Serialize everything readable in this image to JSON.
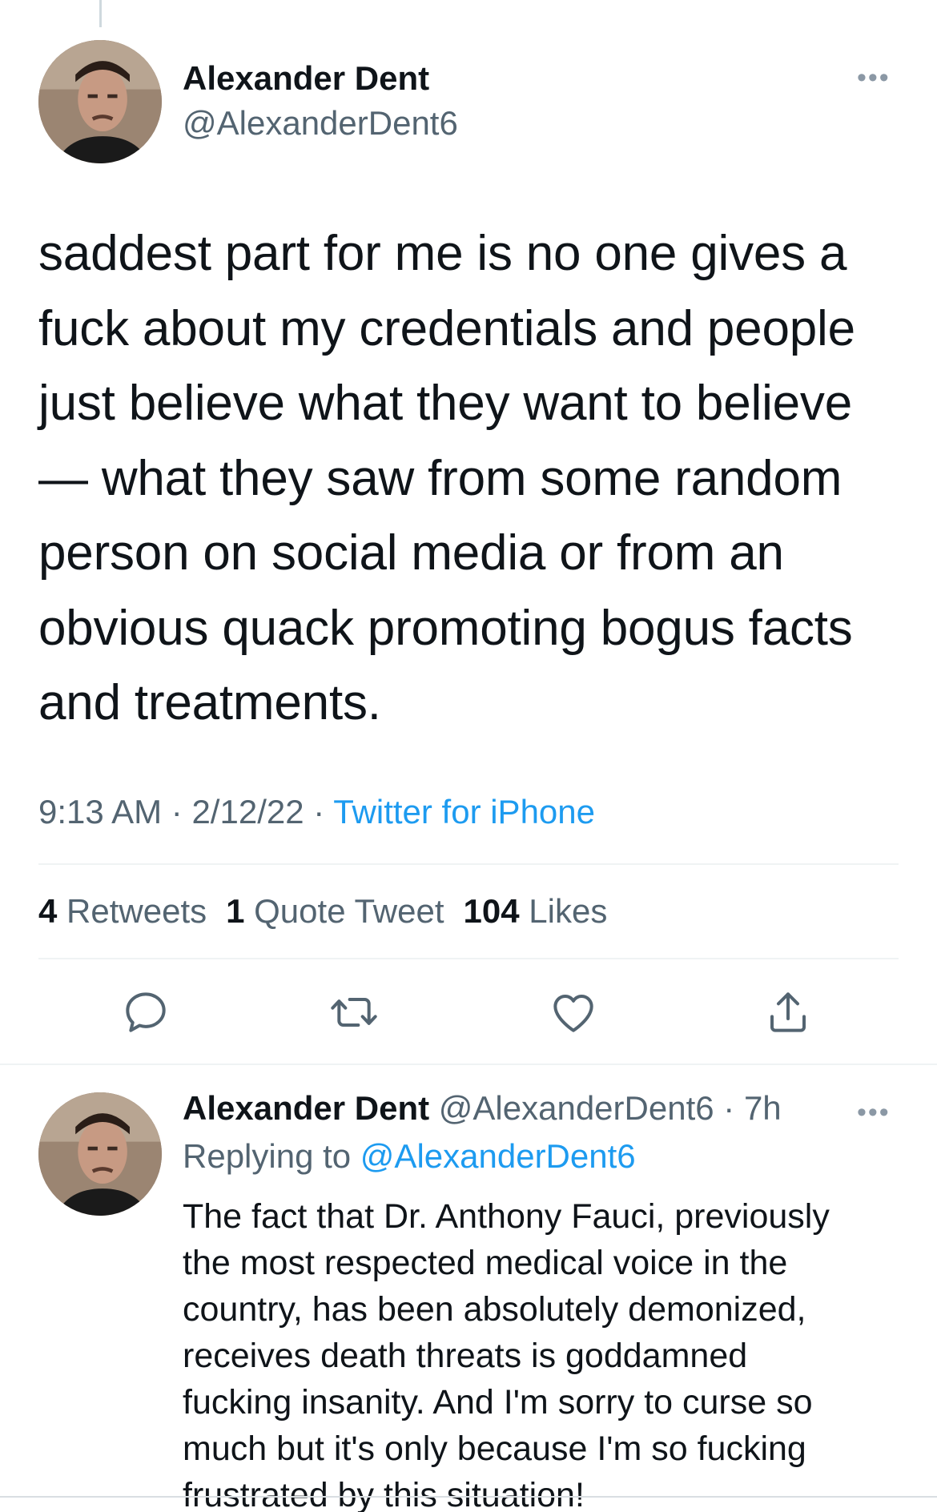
{
  "main_tweet": {
    "author_name": "Alexander Dent",
    "author_handle": "@AlexanderDent6",
    "text_lines": [
      "saddest part for me is no one gives a",
      "fuck about my credentials and people",
      "just believe what they want to believe",
      "— what they saw from some random",
      "person on social media or from an",
      "obvious quack promoting bogus facts",
      "and treatments."
    ],
    "time": "9:13 AM",
    "separator": "·",
    "date": "2/12/22",
    "source": "Twitter for iPhone",
    "stats": {
      "retweets_count": "4",
      "retweets_label": "Retweets",
      "quotes_count": "1",
      "quotes_label": "Quote Tweet",
      "likes_count": "104",
      "likes_label": "Likes"
    },
    "more_icon": "•••"
  },
  "reply_tweet": {
    "author_name": "Alexander Dent",
    "author_handle": "@AlexanderDent6",
    "separator": "·",
    "age": "7h",
    "replying_prefix": "Replying to",
    "replying_to": "@AlexanderDent6",
    "text_lines": [
      "The fact that Dr. Anthony Fauci, previously",
      "the most respected medical voice in the",
      "country, has been absolutely demonized,",
      "receives death threats is goddamned",
      "fucking insanity. And I'm sorry to curse so",
      "much but it's only because I'm so fucking",
      "frustrated by this situation!"
    ],
    "more_icon": "•••"
  },
  "icons": {
    "reply": "reply-icon",
    "retweet": "retweet-icon",
    "like": "heart-icon",
    "share": "share-icon"
  },
  "colors": {
    "text": "#0f1419",
    "secondary": "#536471",
    "link": "#1d9bf0",
    "border": "#eff3f4"
  }
}
